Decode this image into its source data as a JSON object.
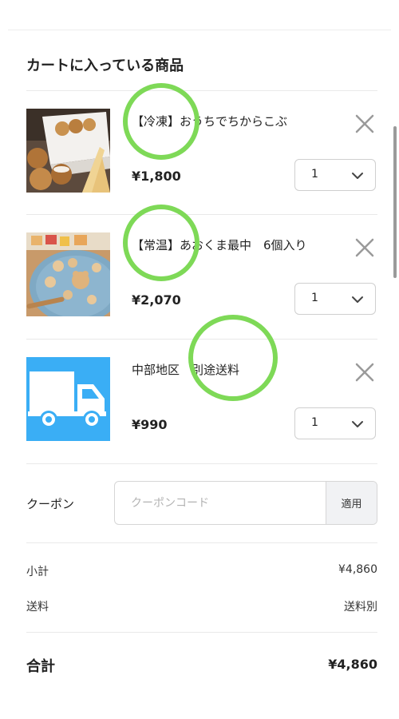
{
  "cart": {
    "title": "カートに入っている商品",
    "items": [
      {
        "name": "【冷凍】おうちでちからこぶ",
        "price": "¥1,800",
        "quantity": "1",
        "thumbnail": "sweets-photo"
      },
      {
        "name": "【常温】あおくま最中　6個入り",
        "price": "¥2,070",
        "quantity": "1",
        "thumbnail": "monaka-photo"
      },
      {
        "name": "中部地区　別途送料",
        "price": "¥990",
        "quantity": "1",
        "thumbnail": "delivery-truck-icon"
      }
    ]
  },
  "coupon": {
    "label": "クーポン",
    "placeholder": "クーポンコード",
    "value": "",
    "apply_label": "適用"
  },
  "summary": {
    "subtotal_label": "小計",
    "subtotal_value": "¥4,860",
    "shipping_label": "送料",
    "shipping_value": "送料別",
    "total_label": "合計",
    "total_value": "¥4,860"
  },
  "icons": {
    "remove": "close-icon",
    "quantity_dropdown": "chevron-down-icon"
  },
  "colors": {
    "highlight_circle": "#7ed957",
    "truck_background": "#3aaef5"
  }
}
